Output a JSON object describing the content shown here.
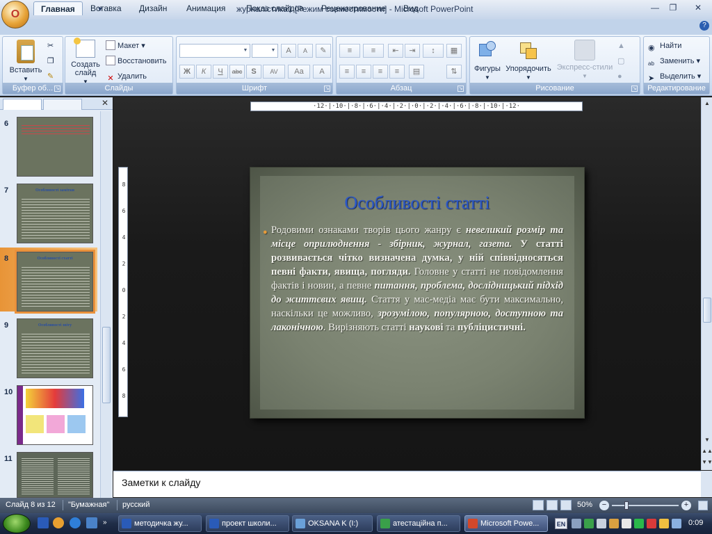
{
  "window": {
    "title": "журналістика1 [Режим совместимости]",
    "app_suffix": " - Microsoft PowerPoint",
    "office_button": "O"
  },
  "tabs": [
    {
      "label": "Главная",
      "active": true
    },
    {
      "label": "Вставка"
    },
    {
      "label": "Дизайн"
    },
    {
      "label": "Анимация"
    },
    {
      "label": "Показ слайдов"
    },
    {
      "label": "Рецензирование"
    },
    {
      "label": "Вид"
    }
  ],
  "ribbon": {
    "clipboard": {
      "paste": "Вставить",
      "label": "Буфер об..."
    },
    "slides": {
      "new_slide": "Создать слайд",
      "layout": "Макет",
      "reset": "Восстановить",
      "delete": "Удалить",
      "label": "Слайды"
    },
    "font": {
      "label": "Шрифт",
      "bold": "Ж",
      "italic": "К",
      "underline": "Ч",
      "strike": "abc",
      "shadow": "S",
      "spacing": "AV",
      "case": "Aa",
      "color": "A",
      "grow": "A",
      "shrink": "A"
    },
    "paragraph": {
      "label": "Абзац"
    },
    "drawing": {
      "shapes": "Фигуры",
      "arrange": "Упорядочить",
      "quick_styles": "Экспресс-стили",
      "label": "Рисование"
    },
    "editing": {
      "find": "Найти",
      "replace": "Заменить",
      "select": "Выделить",
      "label": "Редактирование"
    }
  },
  "thumbnails": [
    {
      "num": "6",
      "title": ""
    },
    {
      "num": "7",
      "title": "Особливості замітки"
    },
    {
      "num": "8",
      "title": "Особливості статті",
      "selected": true
    },
    {
      "num": "9",
      "title": "Особливості звіту"
    },
    {
      "num": "10",
      "title": ""
    },
    {
      "num": "11",
      "title": ""
    }
  ],
  "ruler": {
    "horizontal": "·12·|·10·|·8·|·6·|·4·|·2·|·0·|·2·|·4·|·6·|·8·|·10·|·12·",
    "vertical": [
      "8",
      "6",
      "4",
      "2",
      "0",
      "2",
      "4",
      "6",
      "8"
    ]
  },
  "slide": {
    "title": "Особливості статті",
    "body": {
      "p1": "Родовими ознаками творів цього жанру є ",
      "p2": "невеликий розмір та місце оприлюднення",
      "p3": " - ",
      "p4": "збірник, журнал, газета.",
      "p5": " У статті розвивається чітко визначена думка, у ній співвідносяться певні факти, явища, погляди.",
      "p6": " Головне у статті не повідомлення фактів і новин, а певне ",
      "p7": "питання, проблема, дослідницький підхід до життєвих явищ.",
      "p8": " Стаття у мас-медіа має бути максимально, наскільки це можливо, ",
      "p9": "зрозумілою, популярною, доступною та лаконічною",
      "p10": ". Вирізняють статті ",
      "p11": "наукові",
      "p12": " та ",
      "p13": "публіцистичні."
    }
  },
  "notes": {
    "placeholder": "Заметки к слайду"
  },
  "status": {
    "slide": "Слайд 8 из 12",
    "theme": "\"Бумажная\"",
    "language": "русский",
    "zoom": "50%"
  },
  "taskbar": {
    "tasks": [
      {
        "label": "методичка жу...",
        "color": "#2a5bb8"
      },
      {
        "label": "проект школи...",
        "color": "#2a5bb8"
      },
      {
        "label": "OKSANA K (I:)",
        "color": "#6aa0d8"
      },
      {
        "label": "атестаційна п...",
        "color": "#3aa04a"
      },
      {
        "label": "Microsoft Powe...",
        "color": "#d2482a",
        "active": true
      }
    ],
    "lang": "EN",
    "clock": "0:09"
  },
  "colors": {
    "accent": "#2b58c9",
    "selection": "#e9913b",
    "bullet": "#e59a3a"
  }
}
